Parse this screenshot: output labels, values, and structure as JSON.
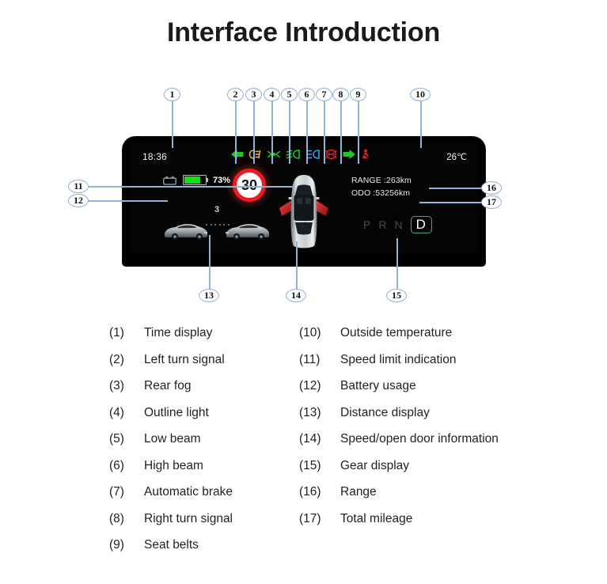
{
  "page": {
    "title": "Interface Introduction"
  },
  "cluster": {
    "status_bar": {
      "time": "18:36",
      "temperature": "26℃",
      "tell_tales": [
        {
          "id": 2,
          "name": "left-turn-signal-icon",
          "color": "#1ec81e"
        },
        {
          "id": 3,
          "name": "rear-fog-light-icon",
          "color": "#e8b13a"
        },
        {
          "id": 4,
          "name": "outline-light-icon",
          "color": "#1ec81e"
        },
        {
          "id": 5,
          "name": "low-beam-icon",
          "color": "#1ec81e"
        },
        {
          "id": 6,
          "name": "high-beam-icon",
          "color": "#3aa0ee"
        },
        {
          "id": 7,
          "name": "automatic-brake-icon",
          "color": "#e02020"
        },
        {
          "id": 8,
          "name": "right-turn-signal-icon",
          "color": "#1ec81e"
        },
        {
          "id": 9,
          "name": "seat-belt-icon",
          "color": "#e02020"
        }
      ]
    },
    "battery": {
      "percent_label": "73%",
      "fill_percent": 73,
      "fill_color": "#14e014"
    },
    "speed_limit": {
      "value": "30",
      "ring_color": "#ee1b24"
    },
    "distance": {
      "value": "3"
    },
    "range_line": "RANGE :263km",
    "odo_line": "ODO :53256km",
    "gear": {
      "options": [
        "P",
        "R",
        "N",
        "D"
      ],
      "selected": "D",
      "active_color": "#4e9e91"
    }
  },
  "callouts": [
    {
      "n": "1"
    },
    {
      "n": "2"
    },
    {
      "n": "3"
    },
    {
      "n": "4"
    },
    {
      "n": "5"
    },
    {
      "n": "6"
    },
    {
      "n": "7"
    },
    {
      "n": "8"
    },
    {
      "n": "9"
    },
    {
      "n": "10"
    },
    {
      "n": "11"
    },
    {
      "n": "12"
    },
    {
      "n": "13"
    },
    {
      "n": "14"
    },
    {
      "n": "15"
    },
    {
      "n": "16"
    },
    {
      "n": "17"
    }
  ],
  "legend": {
    "left": [
      {
        "num": "(1)",
        "label": "Time display"
      },
      {
        "num": "(2)",
        "label": "Left turn signal"
      },
      {
        "num": "(3)",
        "label": "Rear fog"
      },
      {
        "num": "(4)",
        "label": "Outline light"
      },
      {
        "num": "(5)",
        "label": "Low beam"
      },
      {
        "num": "(6)",
        "label": "High beam"
      },
      {
        "num": "(7)",
        "label": "Automatic brake"
      },
      {
        "num": "(8)",
        "label": "Right turn signal"
      },
      {
        "num": "(9)",
        "label": "Seat belts"
      }
    ],
    "right": [
      {
        "num": "(10)",
        "label": "Outside temperature"
      },
      {
        "num": "(11)",
        "label": "Speed limit indication"
      },
      {
        "num": "(12)",
        "label": "Battery usage"
      },
      {
        "num": "(13)",
        "label": "Distance display"
      },
      {
        "num": "(14)",
        "label": "Speed/open door information"
      },
      {
        "num": "(15)",
        "label": "Gear display"
      },
      {
        "num": "(16)",
        "label": "Range"
      },
      {
        "num": "(17)",
        "label": "Total mileage"
      }
    ]
  }
}
